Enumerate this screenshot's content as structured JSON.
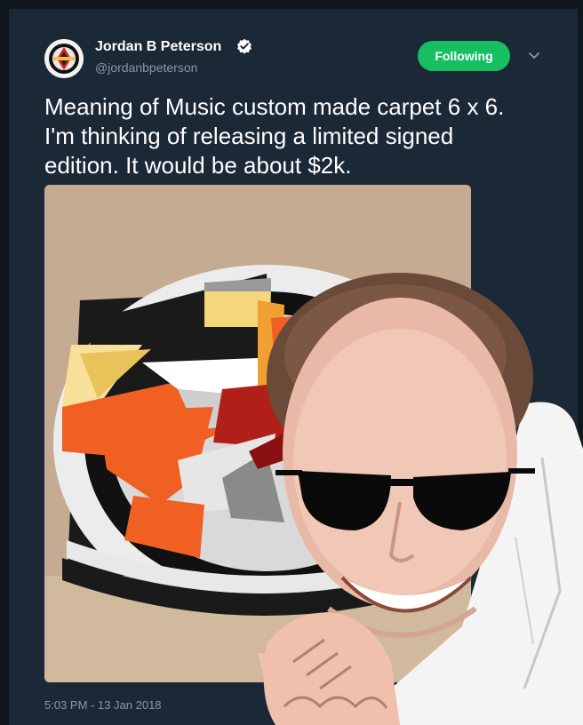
{
  "tweet": {
    "author_name": "Jordan B Peterson",
    "author_handle": "@jordanbpeterson",
    "verified": true,
    "follow_label": "Following",
    "text": "Meaning of Music custom made carpet 6 x 6.\nI'm thinking of releasing a limited signed\nedition. It would be about $2k.",
    "timestamp": "5:03 PM - 13 Jan 2018"
  },
  "media": {
    "description_icon": "carpet-photo"
  },
  "colors": {
    "background": "#1b2836",
    "follow_button": "#17bf63",
    "secondary_text": "#8899a6",
    "verified_badge": "#ffffff"
  },
  "icons": {
    "verified": "verified-badge-icon",
    "dropdown": "chevron-down-icon"
  }
}
